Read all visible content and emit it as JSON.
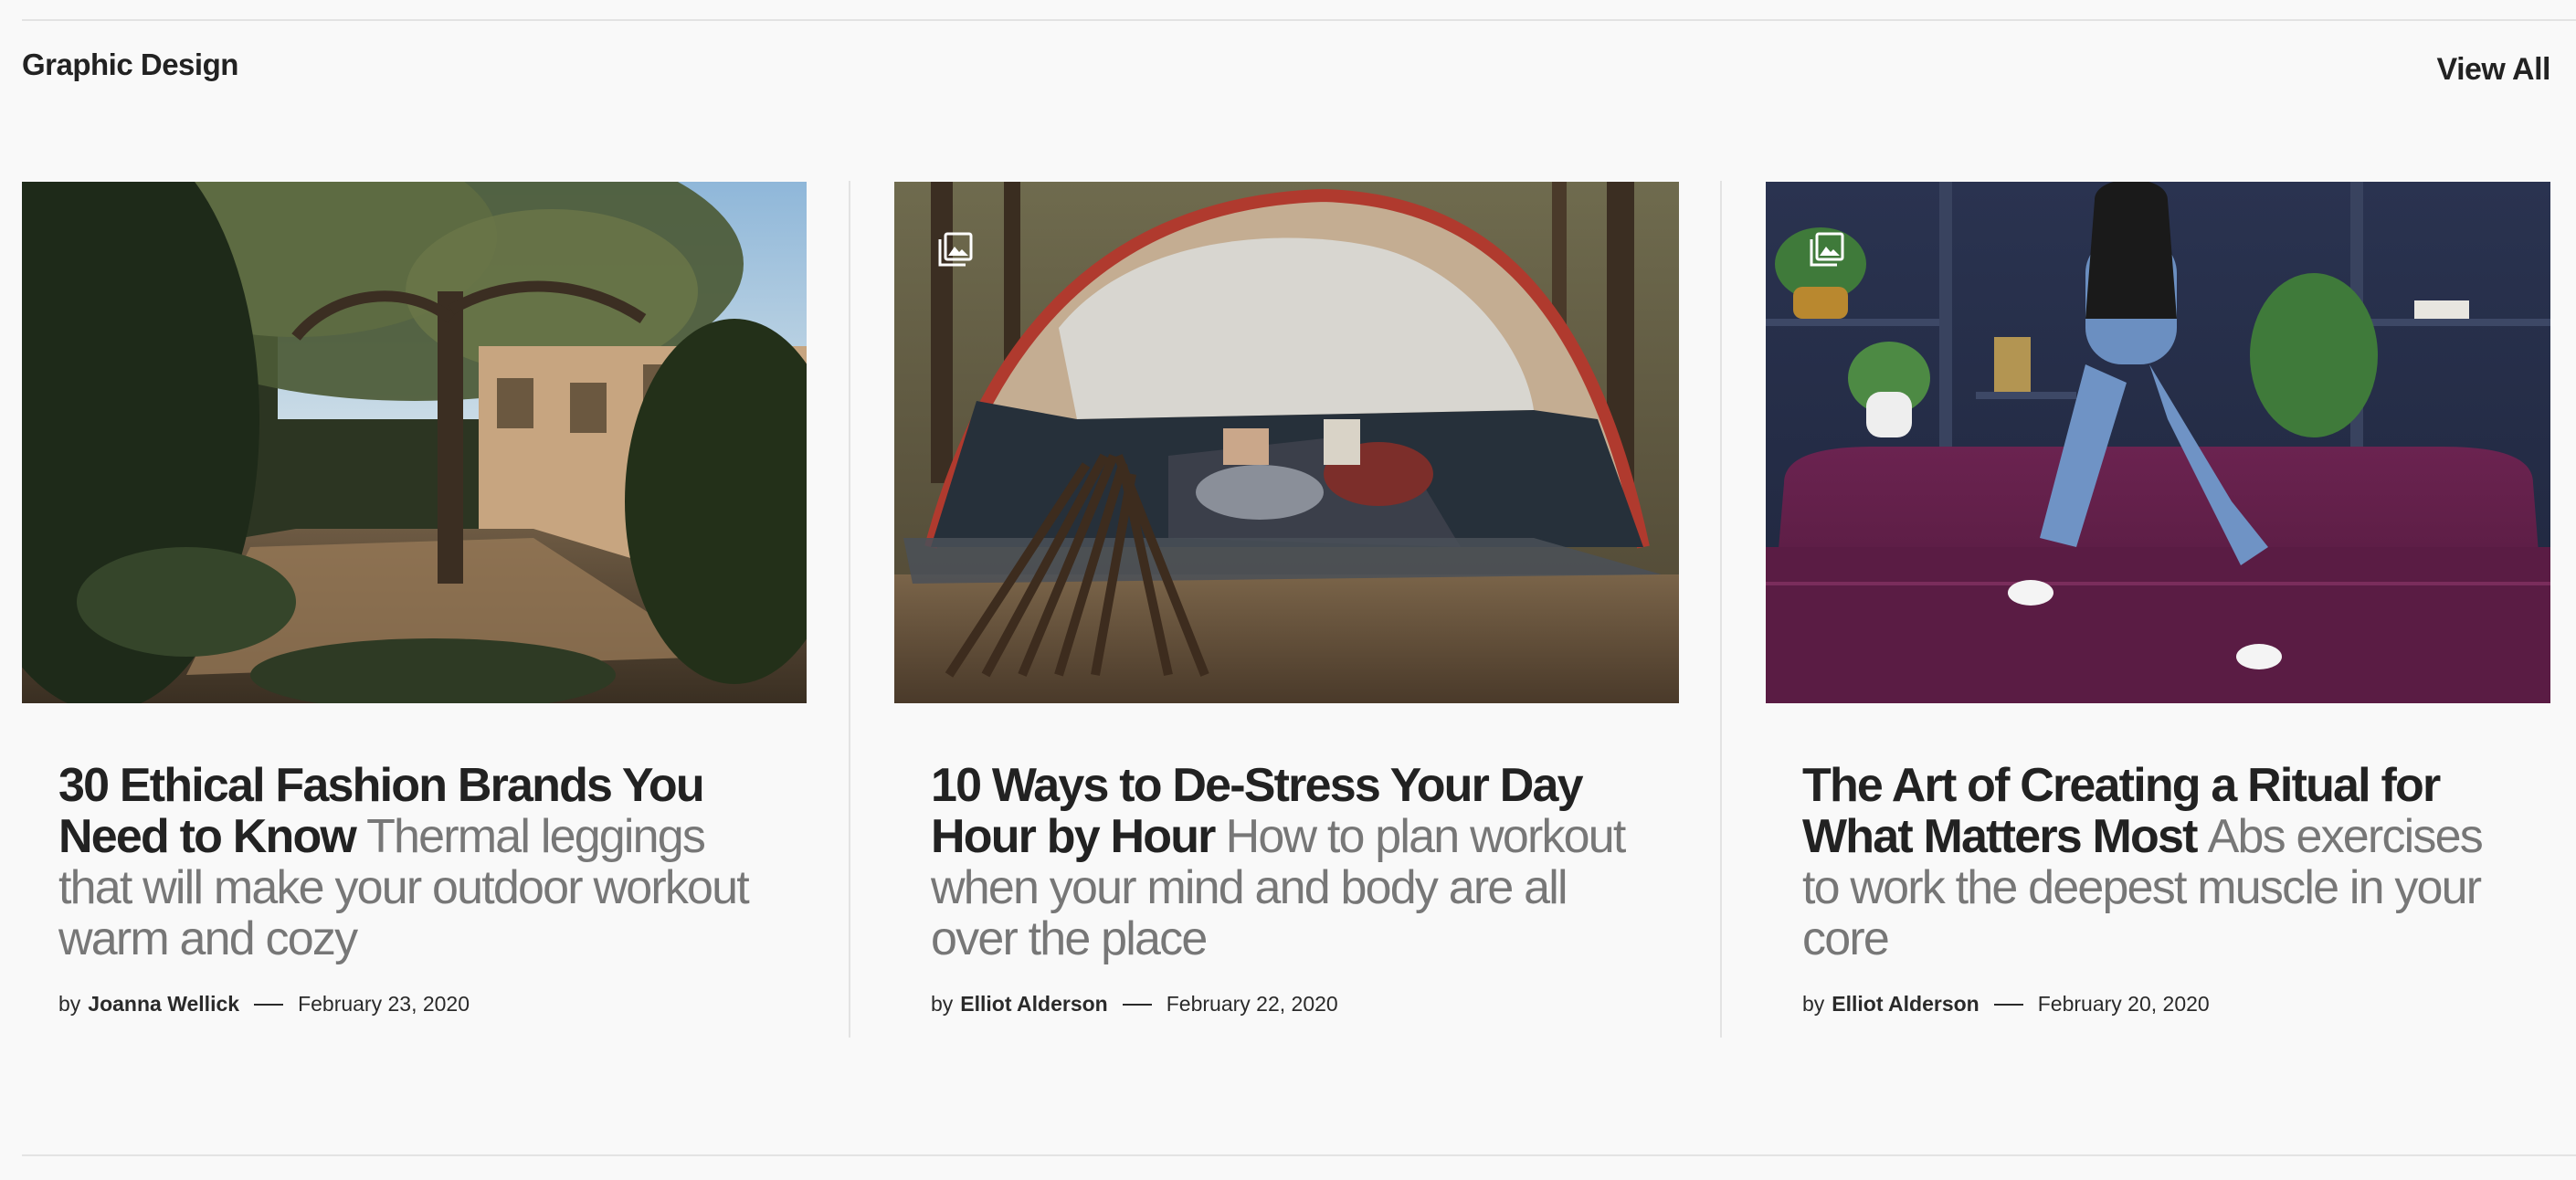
{
  "section": {
    "title": "Graphic Design",
    "view_all_label": "View All"
  },
  "articles": [
    {
      "title": "30 Ethical Fashion Brands You Need to Know",
      "excerpt": "Thermal leggings that will make your outdoor workout warm and cozy",
      "by_label": "by",
      "author": "Joanna Wellick",
      "date": "February 23, 2020",
      "image": "garden-courtyard-with-oak-trees",
      "gallery_icon": false
    },
    {
      "title": "10 Ways to De-Stress Your Day Hour by Hour",
      "excerpt": "How to plan workout when your mind and body are all over the place",
      "by_label": "by",
      "author": "Elliot Alderson",
      "date": "February 22, 2020",
      "image": "couple-reading-in-tent-with-campfire",
      "gallery_icon": "gallery-icon"
    },
    {
      "title": "The Art of Creating a Ritual for What Matters Most",
      "excerpt": "Abs exercises to work the deepest muscle in your core",
      "by_label": "by",
      "author": "Elliot Alderson",
      "date": "February 20, 2020",
      "image": "woman-in-denim-on-purple-velvet-sofa",
      "gallery_icon": "gallery-icon"
    }
  ],
  "colors": {
    "background": "#f9f9f9",
    "heading": "#222222",
    "excerpt": "#777777",
    "rule": "#e3e3e3"
  }
}
